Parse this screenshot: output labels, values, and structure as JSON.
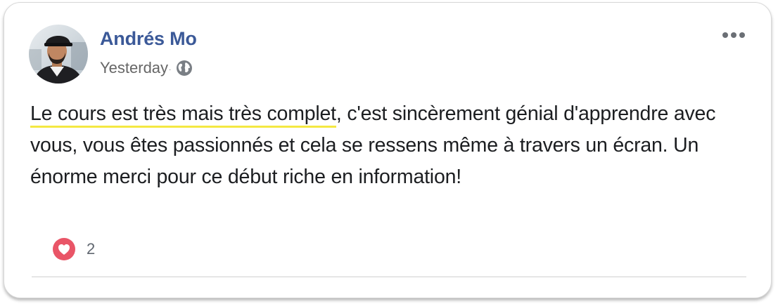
{
  "post": {
    "author": "Andrés Mo",
    "timestamp": "Yesterday",
    "timestamp_separator": "·",
    "privacy_icon": "globe-icon",
    "text_highlighted": "Le cours est très mais très complet",
    "text_rest": ", c'est sincèrement génial d'apprendre avec vous, vous êtes passionnés et cela se ressens même à travers un écran. Un énorme merci pour ce début riche en information!",
    "more_icon": "more-options-icon"
  },
  "reactions": {
    "icon": "heart-icon",
    "count": "2"
  },
  "colors": {
    "author": "#3b5998",
    "highlight": "#f4e842",
    "heart": "#e95567",
    "text": "#1c1e21",
    "muted": "#666666"
  }
}
